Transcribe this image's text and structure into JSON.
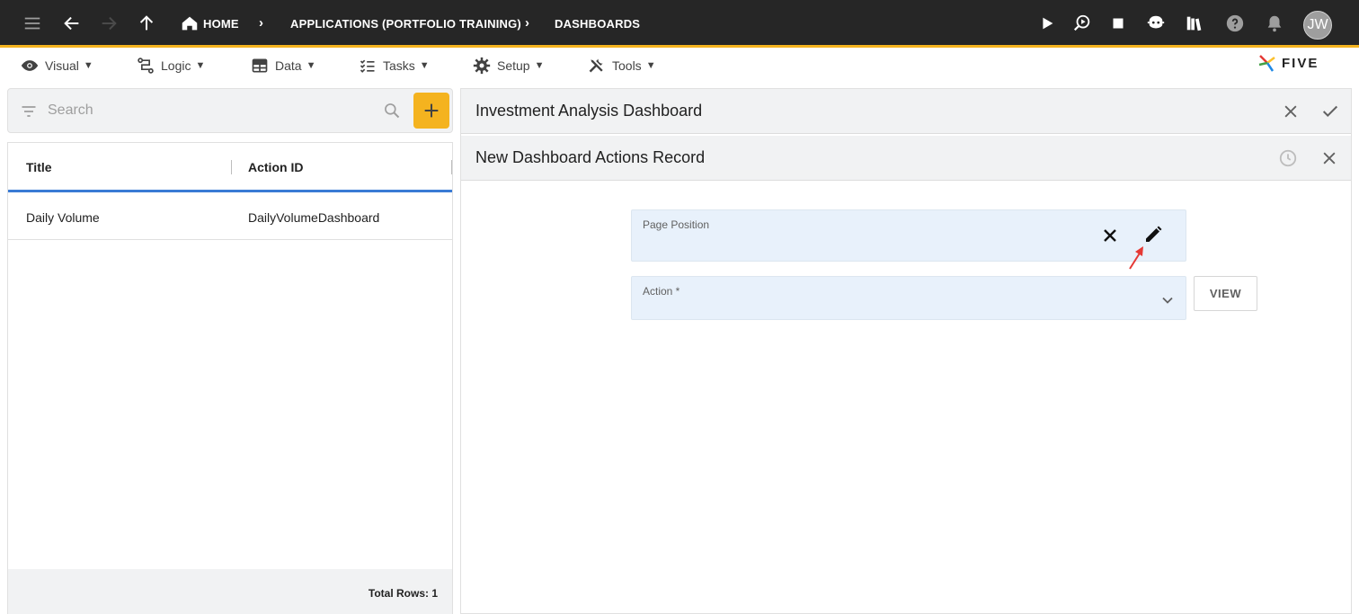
{
  "topbar": {
    "breadcrumbs": [
      "HOME",
      "APPLICATIONS (PORTFOLIO TRAINING)",
      "DASHBOARDS"
    ],
    "avatar_initials": "JW",
    "icons": [
      "menu-icon",
      "back-arrow-icon",
      "forward-arrow-icon",
      "up-arrow-icon",
      "home-icon",
      "play-icon",
      "debug-search-icon",
      "stop-icon",
      "chat-bot-icon",
      "library-icon",
      "help-icon",
      "notifications-icon"
    ],
    "accent_color": "#f4b31f"
  },
  "menubar": {
    "items": [
      {
        "label": "Visual",
        "icon": "eye-icon"
      },
      {
        "label": "Logic",
        "icon": "logic-flow-icon"
      },
      {
        "label": "Data",
        "icon": "table-icon"
      },
      {
        "label": "Tasks",
        "icon": "checklist-icon"
      },
      {
        "label": "Setup",
        "icon": "gear-icon"
      },
      {
        "label": "Tools",
        "icon": "tools-icon"
      }
    ],
    "caret": "▼",
    "logo_text": "FIVE"
  },
  "list": {
    "search_placeholder": "Search",
    "columns": [
      "Title",
      "Action ID"
    ],
    "rows": [
      {
        "title": "Daily Volume",
        "action_id": "DailyVolumeDashboard"
      }
    ],
    "total_label": "Total Rows: 1"
  },
  "detail": {
    "parent_title": "Investment Analysis Dashboard",
    "form_title": "New Dashboard Actions Record",
    "fields": {
      "page_position_label": "Page Position",
      "action_label": "Action *"
    },
    "view_button": "VIEW"
  }
}
